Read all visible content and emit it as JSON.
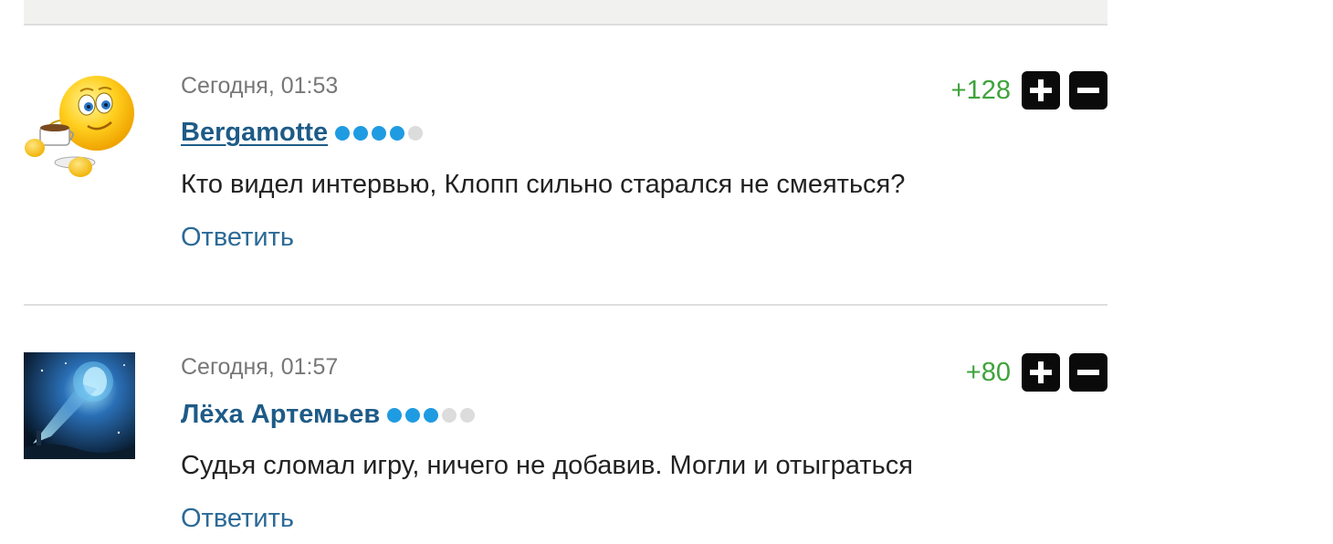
{
  "comments": [
    {
      "time": "Сегодня, 01:53",
      "author": "Bergamotte",
      "level_dots_total": 5,
      "level_dots_filled": 4,
      "text": "Кто видел интервью, Клопп сильно старался не смеяться?",
      "reply_label": "Ответить",
      "score": "+128",
      "avatar_icon": "coffee-smiley-avatar"
    },
    {
      "time": "Сегодня, 01:57",
      "author": "Лёха Артемьев",
      "level_dots_total": 5,
      "level_dots_filled": 3,
      "text": "Судья сломал игру, ничего не добавив. Могли и отыграться",
      "reply_label": "Ответить",
      "score": "+80",
      "avatar_icon": "space-portrait-avatar"
    }
  ],
  "colors": {
    "author": "#1e5b87",
    "reply": "#2c6a97",
    "score_positive": "#3ea33b",
    "dot_filled": "#1f9be2",
    "dot_empty": "#dcdcdc"
  }
}
